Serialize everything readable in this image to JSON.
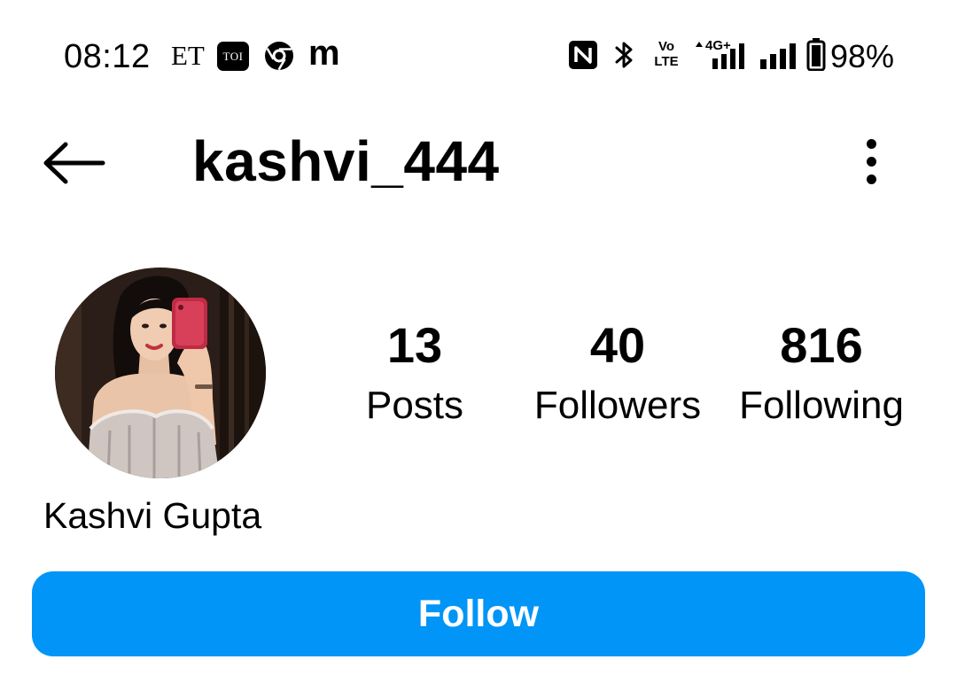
{
  "status_bar": {
    "time": "08:12",
    "notification_icons": [
      {
        "name": "et-icon",
        "text": "ET"
      },
      {
        "name": "toi-icon",
        "text": "TOI"
      },
      {
        "name": "chrome-icon"
      },
      {
        "name": "m-icon",
        "text": "m"
      }
    ],
    "system_icons": [
      "nfc-icon",
      "bluetooth-icon",
      "volte-icon",
      "signal-4g-icon",
      "signal-icon",
      "battery-icon"
    ],
    "volte_line1": "Vo",
    "volte_line2": "LTE",
    "network_type": "4G+",
    "battery_percent": "98%"
  },
  "header": {
    "back_icon": "arrow-left-icon",
    "username": "kashvi_444",
    "menu_icon": "more-vertical-icon"
  },
  "profile": {
    "avatar_icon": "profile-photo",
    "display_name": "Kashvi Gupta",
    "stats": {
      "posts": {
        "value": "13",
        "label": "Posts"
      },
      "followers": {
        "value": "40",
        "label": "Followers"
      },
      "following": {
        "value": "816",
        "label": "Following"
      }
    }
  },
  "actions": {
    "follow_label": "Follow"
  },
  "colors": {
    "follow_button_bg": "#0095f6",
    "follow_button_text": "#ffffff",
    "background": "#ffffff",
    "text": "#000000"
  }
}
